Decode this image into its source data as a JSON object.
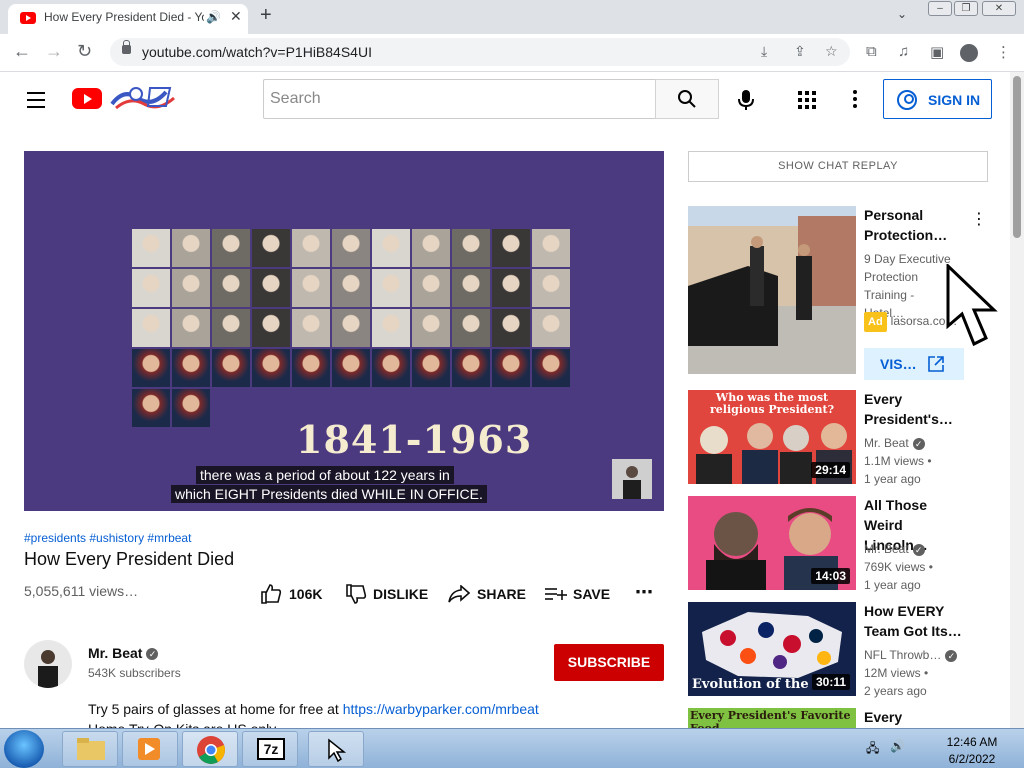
{
  "browser": {
    "tab_title": "How Every President Died - YouTube",
    "tab_audio_icon": "speaker-icon",
    "url": "youtube.com/watch?v=P1HiB84S4UI"
  },
  "header": {
    "search_placeholder": "Search",
    "sign_in": "SIGN IN"
  },
  "video": {
    "overlay_year": "1841-1963",
    "caption_line1": "there was a period of about 122 years in",
    "caption_line2": "which EIGHT Presidents died WHILE IN OFFICE.",
    "hashtags": "#presidents #ushistory #mrbeat",
    "title": "How Every President Died",
    "views": "5,055,611 views…",
    "actions": {
      "like": "106K",
      "dislike": "DISLIKE",
      "share": "SHARE",
      "save": "SAVE"
    },
    "channel": {
      "name": "Mr. Beat",
      "subscribers": "543K subscribers",
      "subscribe": "SUBSCRIBE"
    },
    "description": {
      "text": "Try 5 pairs of glasses at home for free at ",
      "link": "https://warbyparker.com/mrbeat",
      "line2": "Home Try-On Kits are US only"
    }
  },
  "sidebar": {
    "chat_replay": "SHOW CHAT REPLAY",
    "ad": {
      "title": "Personal Protection…",
      "desc": "9 Day Executive Protection Training - Hotel…",
      "badge": "Ad",
      "domain": "lasorsa.co…",
      "visit": "VIS…"
    },
    "recommendations": [
      {
        "title": "Every President's…",
        "channel": "Mr. Beat",
        "views": "1.1M views •",
        "age": "1 year ago",
        "duration": "29:14",
        "thumb_text": "Who was the most religious President?"
      },
      {
        "title": "All Those Weird Lincoln…",
        "channel": "Mr. Beat",
        "views": "769K views •",
        "age": "1 year ago",
        "duration": "14:03"
      },
      {
        "title": "How EVERY Team Got Its…",
        "channel": "NFL Throwb…",
        "views": "12M views •",
        "age": "2 years ago",
        "duration": "30:11",
        "thumb_text": "Evolution of the"
      },
      {
        "title": "Every",
        "thumb_text": "Every President's Favorite Food"
      }
    ]
  },
  "taskbar": {
    "time": "12:46 AM",
    "date": "6/2/2022"
  },
  "colors": {
    "youtube_red": "#ff0000",
    "link_blue": "#065fd4",
    "video_bg": "#4b3a7f",
    "subscribe_red": "#cc0000"
  }
}
